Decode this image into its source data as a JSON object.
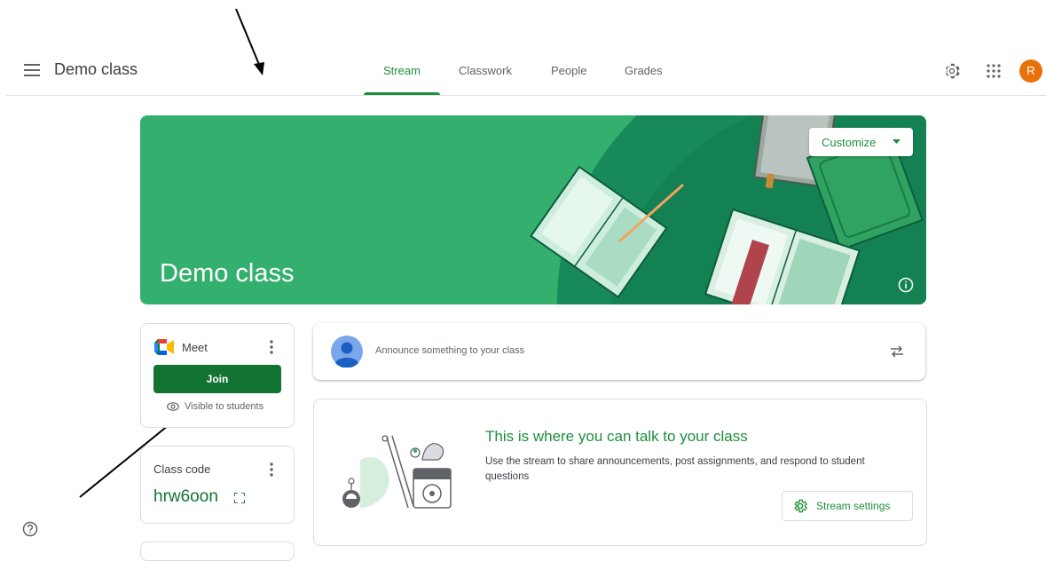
{
  "header": {
    "class_title": "Demo class",
    "tabs": [
      {
        "label": "Stream",
        "active": true
      },
      {
        "label": "Classwork",
        "active": false
      },
      {
        "label": "People",
        "active": false
      },
      {
        "label": "Grades",
        "active": false
      }
    ],
    "avatar_initial": "R",
    "icons": [
      "menu-icon",
      "settings-icon",
      "apps-grid-icon"
    ]
  },
  "banner": {
    "title": "Demo class",
    "customize_label": "Customize",
    "color": "#33af6e"
  },
  "meet_card": {
    "label": "Meet",
    "join_label": "Join",
    "visibility_text": "Visible to students"
  },
  "class_code_card": {
    "label": "Class code",
    "code": "hrw6oon"
  },
  "announce": {
    "placeholder": "Announce something to your class"
  },
  "talk_card": {
    "title": "This is where you can talk to your class",
    "description": "Use the stream to share announcements, post assignments, and respond to student questions",
    "button_label": "Stream settings"
  },
  "colors": {
    "accent_green": "#1e8e3e",
    "join_green": "#137333",
    "avatar_orange": "#e8710a"
  }
}
